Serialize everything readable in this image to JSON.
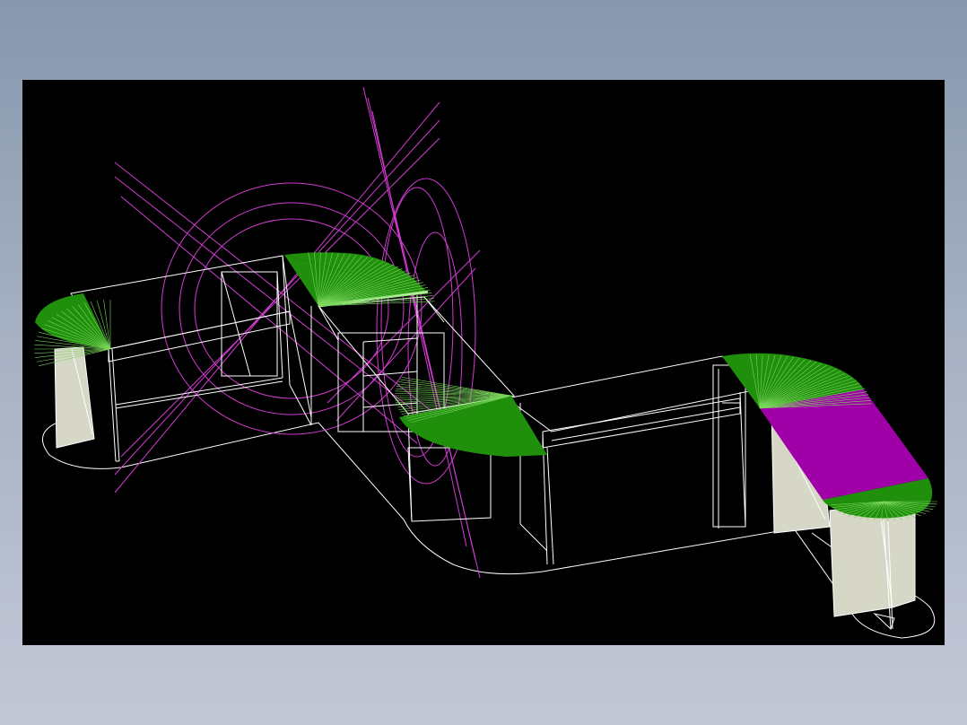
{
  "viewport": {
    "background": "#000000",
    "wireframe_color": "#ffffff",
    "construction_color": "#d23cd2",
    "counter_top_color": "#1f8f0c",
    "desk_top_color": "#a000a8",
    "panel_color": "#d6d7c6"
  },
  "icons": [
    "cad-model"
  ]
}
